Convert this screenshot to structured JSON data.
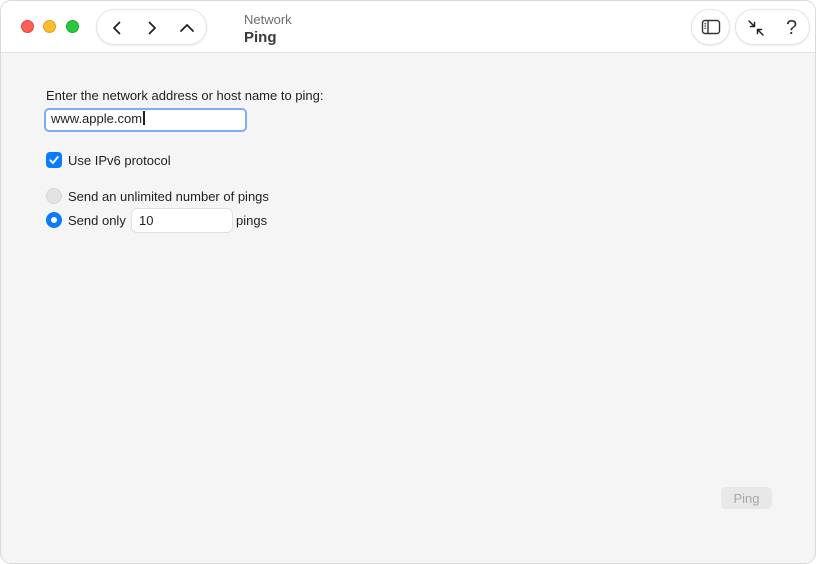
{
  "window": {
    "section_title": "Network",
    "page_title": "Ping"
  },
  "toolbar": {
    "back_icon": "chevron-left-icon",
    "forward_icon": "chevron-right-icon",
    "up_icon": "chevron-up-icon",
    "sidebar_icon": "sidebar-icon",
    "collapse_icon": "arrows-collapse-icon",
    "help_label": "?"
  },
  "form": {
    "prompt": "Enter the network address or host name to ping:",
    "address_value": "www.apple.com",
    "ipv6_label": "Use IPv6 protocol",
    "ipv6_checked": true,
    "unlimited_label": "Send an unlimited number of pings",
    "send_only_label": "Send only",
    "ping_count": "10",
    "pings_suffix": "pings",
    "selected_option": "send_only"
  },
  "actions": {
    "ping_label": "Ping",
    "ping_enabled": false
  },
  "colors": {
    "accent": "#0a7aff",
    "focus_ring": "#80aef0",
    "close": "#fe5f57",
    "minimize": "#febc2e",
    "maximize": "#28c840"
  }
}
